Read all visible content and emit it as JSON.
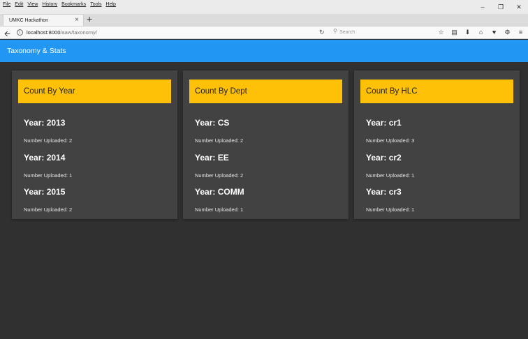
{
  "browser": {
    "menu": [
      "File",
      "Edit",
      "View",
      "History",
      "Bookmarks",
      "Tools",
      "Help"
    ],
    "tab_title": "UMKC Hackathon",
    "url_host": "localhost:8000",
    "url_path": "/aaw/taxonomy/",
    "search_placeholder": "Search"
  },
  "app": {
    "title": "Taxonomy & Stats"
  },
  "cards": [
    {
      "heading": "Count By Year",
      "entries": [
        {
          "title": "Year: 2013",
          "count": "Number Uploaded: 2"
        },
        {
          "title": "Year: 2014",
          "count": "Number Uploaded: 1"
        },
        {
          "title": "Year: 2015",
          "count": "Number Uploaded: 2"
        }
      ]
    },
    {
      "heading": "Count By Dept",
      "entries": [
        {
          "title": "Year: CS",
          "count": "Number Uploaded: 2"
        },
        {
          "title": "Year: EE",
          "count": "Number Uploaded: 2"
        },
        {
          "title": "Year: COMM",
          "count": "Number Uploaded: 1"
        }
      ]
    },
    {
      "heading": "Count By HLC",
      "entries": [
        {
          "title": "Year: cr1",
          "count": "Number Uploaded: 3"
        },
        {
          "title": "Year: cr2",
          "count": "Number Uploaded: 1"
        },
        {
          "title": "Year: cr3",
          "count": "Number Uploaded: 1"
        }
      ]
    }
  ],
  "colors": {
    "header": "#2196f3",
    "card_header": "#ffc107",
    "card_bg": "#424242",
    "page_bg": "#303030"
  }
}
